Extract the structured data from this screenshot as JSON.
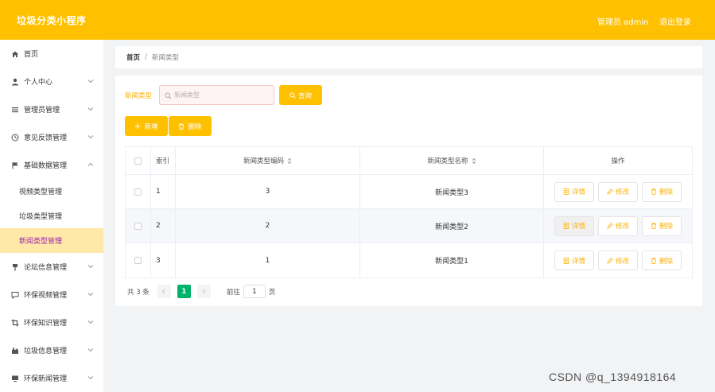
{
  "header": {
    "title": "垃圾分类小程序",
    "user": "管理员 admin",
    "logout": "退出登录"
  },
  "sidebar": {
    "items": [
      {
        "label": "首页",
        "icon": "home-icon"
      },
      {
        "label": "个人中心",
        "icon": "user-icon"
      },
      {
        "label": "管理员管理",
        "icon": "list-icon"
      },
      {
        "label": "意见反馈管理",
        "icon": "clock-icon"
      },
      {
        "label": "基础数据管理",
        "icon": "flag-icon"
      },
      {
        "label": "论坛信息管理",
        "icon": "pin-icon"
      },
      {
        "label": "环保视频管理",
        "icon": "chat-icon"
      },
      {
        "label": "环保知识管理",
        "icon": "crop-icon"
      },
      {
        "label": "垃圾信息管理",
        "icon": "house-icon"
      },
      {
        "label": "环保新闻管理",
        "icon": "monitor-icon"
      }
    ],
    "submenu": [
      "视频类型管理",
      "垃圾类型管理",
      "新闻类型管理"
    ]
  },
  "breadcrumb": {
    "home": "首页",
    "separator": "/",
    "current": "新闻类型"
  },
  "search": {
    "label": "新闻类型",
    "placeholder": "新闻类型",
    "button": "查询"
  },
  "actions": {
    "add": "新增",
    "delete": "删除"
  },
  "table": {
    "headers": {
      "index": "索引",
      "code": "新闻类型编码",
      "name": "新闻类型名称",
      "ops": "操作"
    },
    "rows": [
      {
        "index": "1",
        "code": "3",
        "name": "新闻类型3"
      },
      {
        "index": "2",
        "code": "2",
        "name": "新闻类型2"
      },
      {
        "index": "3",
        "code": "1",
        "name": "新闻类型1"
      }
    ],
    "op_labels": {
      "detail": "详情",
      "edit": "修改",
      "delete": "删除"
    }
  },
  "pagination": {
    "total": "共 3 条",
    "current_page": "1",
    "goto_prefix": "前往",
    "goto_value": "1",
    "goto_suffix": "页"
  },
  "watermark": "CSDN @q_1394918164",
  "colors": {
    "accent": "#ffc000",
    "active_bg": "#ffe8a8",
    "active_text": "#9c27b0",
    "page_active": "#00b36b"
  }
}
